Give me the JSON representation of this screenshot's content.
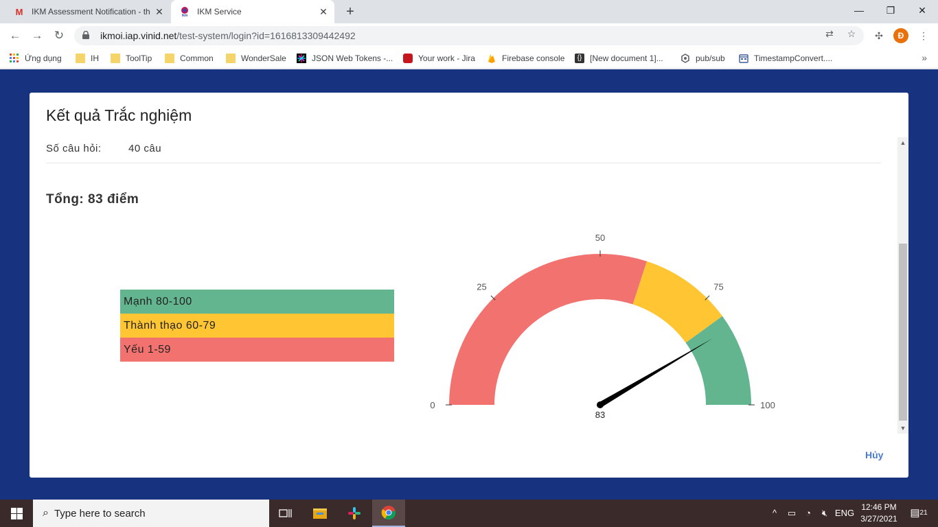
{
  "browser": {
    "tabs": [
      {
        "title": "IKM Assessment Notification - th",
        "favicon": "gmail-icon"
      },
      {
        "title": "IKM Service",
        "favicon": "ikm-icon"
      }
    ],
    "url_host": "ikmoi.iap.vinid.net",
    "url_path": "/test-system/login?id=1616813309442492",
    "avatar_letter": "Đ",
    "bookmarks": [
      {
        "label": "Ứng dụng",
        "icon": "apps-grid-icon"
      },
      {
        "label": "IH",
        "icon": "folder-icon"
      },
      {
        "label": "ToolTip",
        "icon": "folder-icon"
      },
      {
        "label": "Common",
        "icon": "folder-icon"
      },
      {
        "label": "WonderSale",
        "icon": "folder-icon"
      },
      {
        "label": "JSON Web Tokens -...",
        "icon": "jwt-icon"
      },
      {
        "label": "Your work - Jira",
        "icon": "jira-icon"
      },
      {
        "label": "Firebase console",
        "icon": "firebase-icon"
      },
      {
        "label": "[New document 1]...",
        "icon": "braces-icon"
      },
      {
        "label": "pub/sub",
        "icon": "pubsub-icon"
      },
      {
        "label": "TimestampConvert....",
        "icon": "timestamp-icon"
      }
    ]
  },
  "result": {
    "title": "Kết quả Trắc nghiệm",
    "questions_label": "Số câu hỏi:",
    "questions_value": "40 câu",
    "total": "Tổng: 83 điểm",
    "legend": [
      {
        "label": "Mạnh 80-100",
        "color": "#63b58f"
      },
      {
        "label": "Thành thạo 60-79",
        "color": "#ffc533"
      },
      {
        "label": "Yếu 1-59",
        "color": "#f2726f"
      }
    ],
    "cancel_label": "Hủy"
  },
  "chart_data": {
    "type": "gauge",
    "min": 0,
    "max": 100,
    "value": 83,
    "value_label": "83",
    "ticks": [
      0,
      25,
      50,
      75,
      100
    ],
    "tick_labels": [
      "0",
      "25",
      "50",
      "75",
      "100"
    ],
    "bands": [
      {
        "from": 0,
        "to": 60,
        "color": "#f2726f"
      },
      {
        "from": 60,
        "to": 80,
        "color": "#ffc533"
      },
      {
        "from": 80,
        "to": 100,
        "color": "#63b58f"
      }
    ]
  },
  "taskbar": {
    "search_placeholder": "Type here to search",
    "language": "ENG",
    "time": "12:46 PM",
    "date": "3/27/2021",
    "notification_count": "21"
  }
}
